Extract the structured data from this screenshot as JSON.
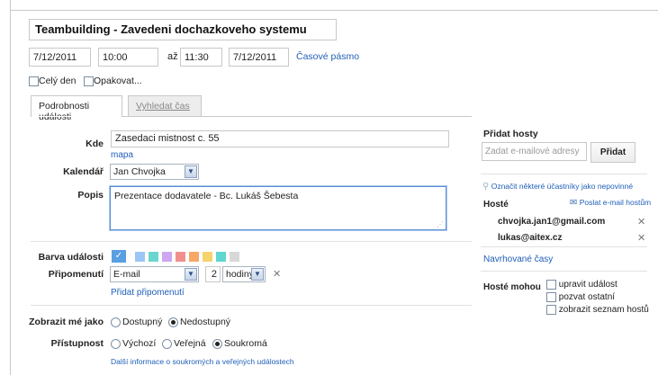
{
  "event": {
    "title": "Teamb­u­ilding - Zavedeni dochazkoveho systemu",
    "start_date": "7/12/2011",
    "start_time": "10:00",
    "to_label": "až",
    "end_time": "11:30",
    "end_date": "7/12/2011",
    "timezone_link": "Časové pásmo",
    "all_day_label": "Celý den",
    "repeat_label": "Opakovat..."
  },
  "tabs": {
    "details": "Podrobnosti události",
    "find_time": "Vyhledat čas"
  },
  "details": {
    "where_label": "Kde",
    "where_value": "Zasedaci mistnost c. 55",
    "map_link": "mapa",
    "calendar_label": "Kalendář",
    "calendar_value": "Jan Chvojka",
    "description_label": "Popis",
    "description_value": "Prezentace dodavatele - Bc. Lukáš Šebesta",
    "color_label": "Barva události",
    "colors": [
      "#5a9fe0",
      "#9cc6f5",
      "#6bd5d0",
      "#cfa6f0",
      "#f18f8f",
      "#f7a766",
      "#f5d36d",
      "#5fd6cf",
      "#d8d8d8"
    ],
    "reminder_label": "Připomenutí",
    "reminder_type": "E-mail",
    "reminder_amount": "2",
    "reminder_unit": "hodiny",
    "add_reminder_link": "Přidat připomenutí",
    "show_me_label": "Zobrazit mé jako",
    "available": "Dostupný",
    "busy": "Nedostupný",
    "privacy_label": "Přístupnost",
    "privacy_default": "Výchozí",
    "privacy_public": "Veřejná",
    "privacy_private": "Soukromá",
    "privacy_info_link": "Další informace o soukromých a veřejných událostech"
  },
  "guests": {
    "add_header": "Přidat hosty",
    "email_placeholder": "Zadat e-mailové adresy",
    "add_button": "Přidat",
    "optional_link": "Označit některé účastníky jako nepovinné",
    "guests_label": "Hosté",
    "email_guests_link": "Poslat e-mail hostům",
    "list": [
      {
        "email": "chvojka.jan1@gmail.com"
      },
      {
        "email": "lukas@aitex.cz"
      }
    ],
    "suggested_link": "Navrhované časy",
    "can_label": "Hosté mohou",
    "can_modify": "upravit událost",
    "can_invite": "pozvat ostatní",
    "can_see_list": "zobrazit seznam hostů"
  }
}
